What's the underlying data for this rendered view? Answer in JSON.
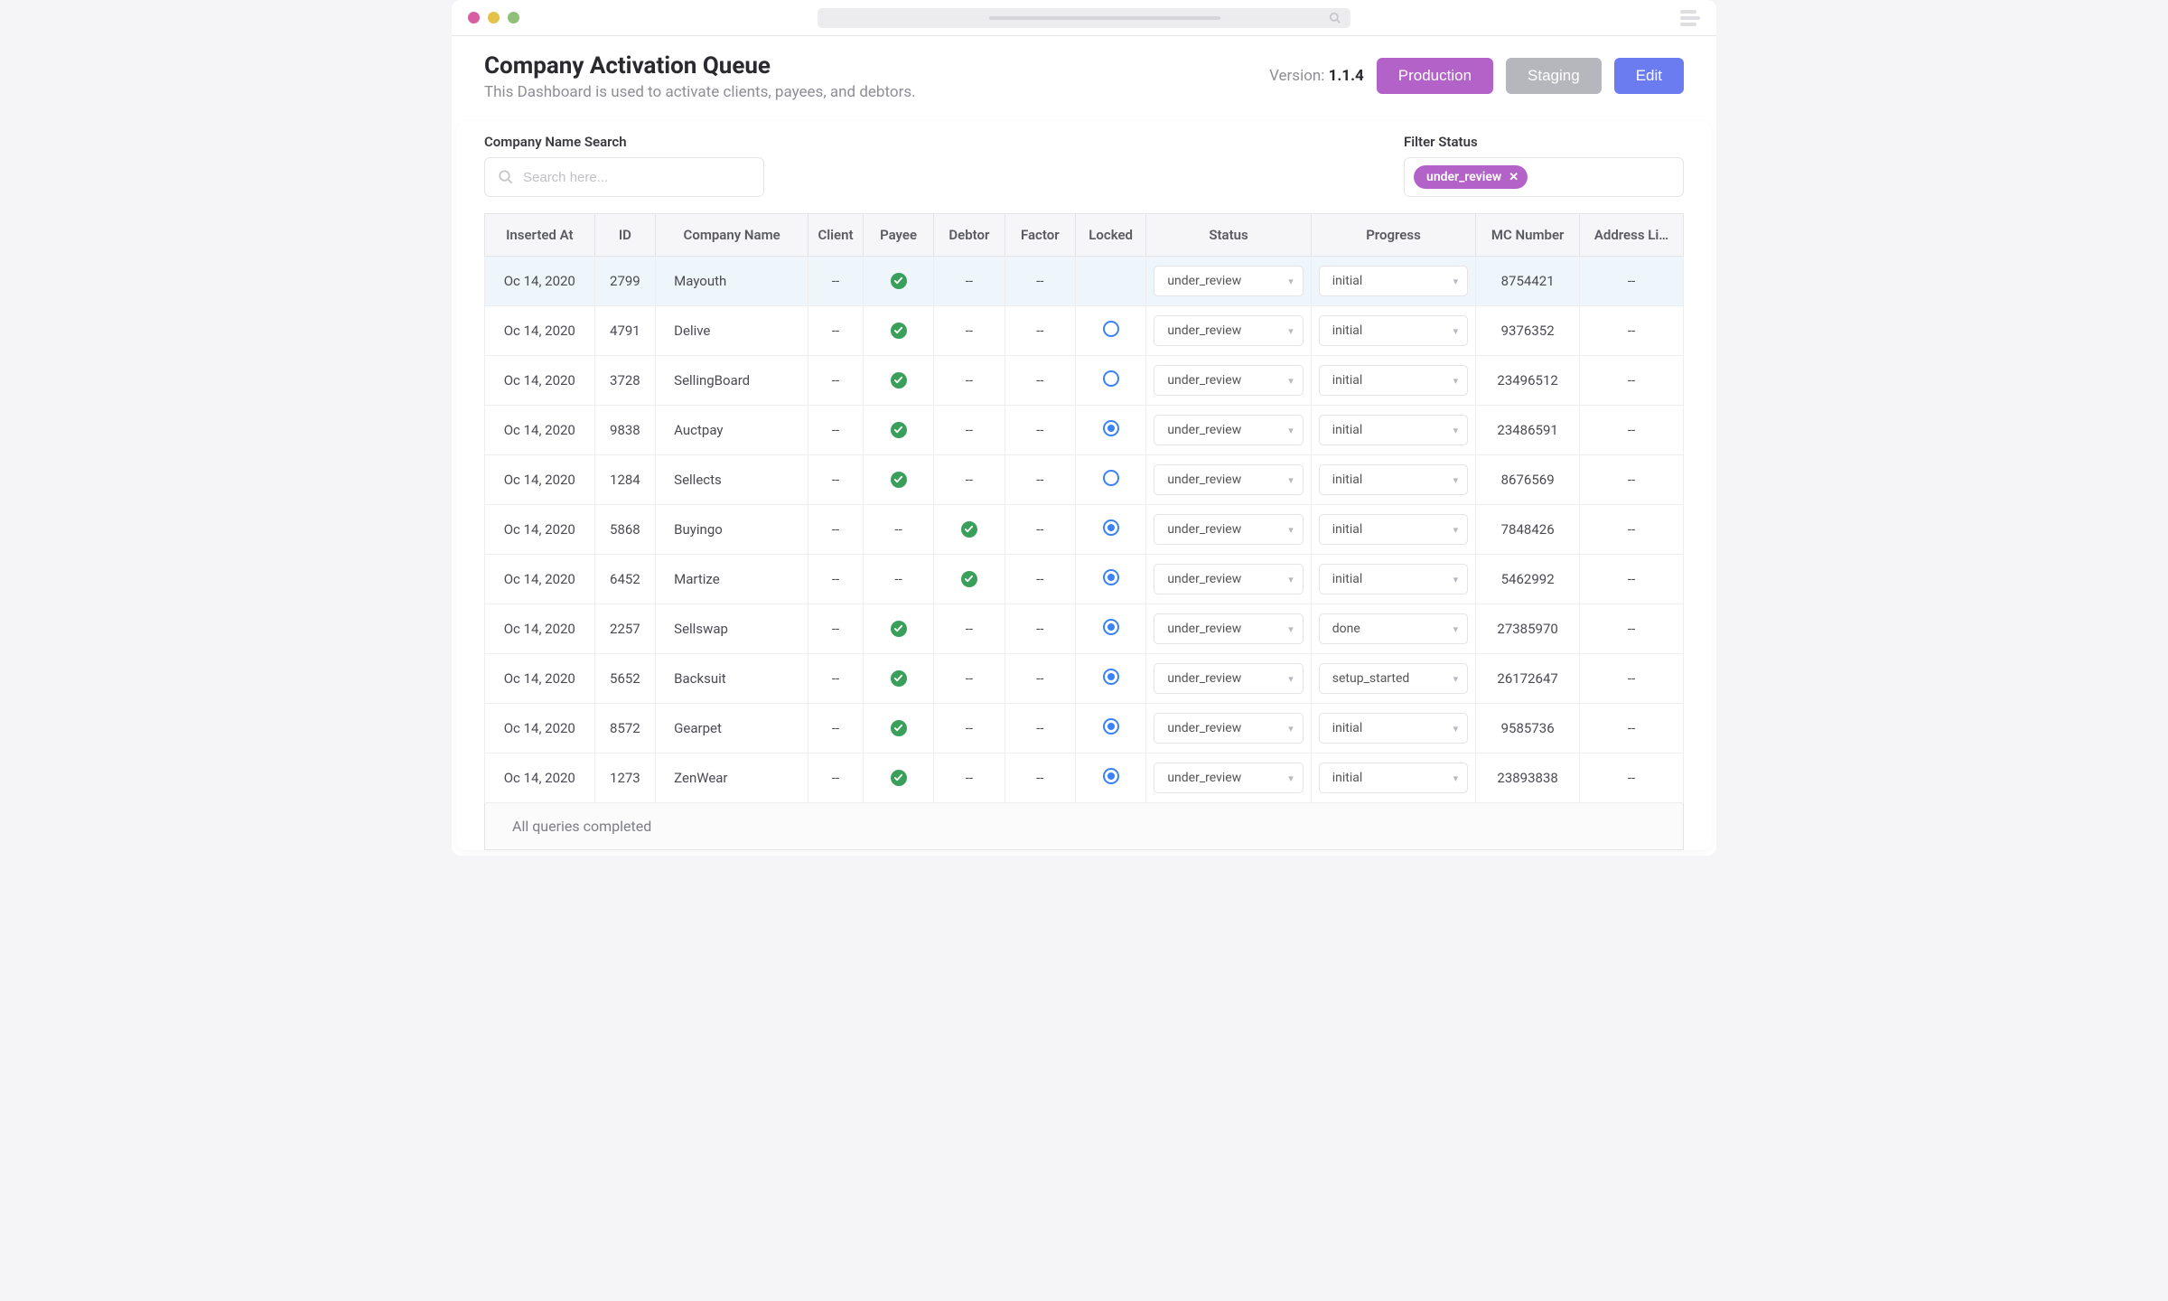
{
  "header": {
    "title": "Company Activation Queue",
    "subtitle": "This Dashboard is used to activate clients, payees, and debtors.",
    "version_label": "Version: ",
    "version": "1.1.4",
    "btn_production": "Production",
    "btn_staging": "Staging",
    "btn_edit": "Edit"
  },
  "search": {
    "label": "Company Name Search",
    "placeholder": "Search here..."
  },
  "filter": {
    "label": "Filter Status",
    "chip": "under_review"
  },
  "columns": {
    "inserted_at": "Inserted At",
    "id": "ID",
    "company_name": "Company Name",
    "client": "Client",
    "payee": "Payee",
    "debtor": "Debtor",
    "factor": "Factor",
    "locked": "Locked",
    "status": "Status",
    "progress": "Progress",
    "mc_number": "MC Number",
    "address": "Address Li…"
  },
  "dash": "--",
  "rows": [
    {
      "inserted_at": "Oc 14, 2020",
      "id": "2799",
      "name": "Mayouth",
      "client": "dash",
      "payee": "check",
      "debtor": "dash",
      "factor": "dash",
      "locked": "none",
      "status": "under_review",
      "progress": "initial",
      "mc": "8754421",
      "addr": "--",
      "hl": true
    },
    {
      "inserted_at": "Oc 14, 2020",
      "id": "4791",
      "name": "Delive",
      "client": "dash",
      "payee": "check",
      "debtor": "dash",
      "factor": "dash",
      "locked": "open",
      "status": "under_review",
      "progress": "initial",
      "mc": "9376352",
      "addr": "--"
    },
    {
      "inserted_at": "Oc 14, 2020",
      "id": "3728",
      "name": "SellingBoard",
      "client": "dash",
      "payee": "check",
      "debtor": "dash",
      "factor": "dash",
      "locked": "open",
      "status": "under_review",
      "progress": "initial",
      "mc": "23496512",
      "addr": "--"
    },
    {
      "inserted_at": "Oc 14, 2020",
      "id": "9838",
      "name": "Auctpay",
      "client": "dash",
      "payee": "check",
      "debtor": "dash",
      "factor": "dash",
      "locked": "filled",
      "status": "under_review",
      "progress": "initial",
      "mc": "23486591",
      "addr": "--"
    },
    {
      "inserted_at": "Oc 14, 2020",
      "id": "1284",
      "name": "Sellects",
      "client": "dash",
      "payee": "check",
      "debtor": "dash",
      "factor": "dash",
      "locked": "open",
      "status": "under_review",
      "progress": "initial",
      "mc": "8676569",
      "addr": "--"
    },
    {
      "inserted_at": "Oc 14, 2020",
      "id": "5868",
      "name": "Buyingo",
      "client": "dash",
      "payee": "dash",
      "debtor": "check",
      "factor": "dash",
      "locked": "filled",
      "status": "under_review",
      "progress": "initial",
      "mc": "7848426",
      "addr": "--"
    },
    {
      "inserted_at": "Oc 14, 2020",
      "id": "6452",
      "name": "Martize",
      "client": "dash",
      "payee": "dash",
      "debtor": "check",
      "factor": "dash",
      "locked": "filled",
      "status": "under_review",
      "progress": "initial",
      "mc": "5462992",
      "addr": "--"
    },
    {
      "inserted_at": "Oc 14, 2020",
      "id": "2257",
      "name": "Sellswap",
      "client": "dash",
      "payee": "check",
      "debtor": "dash",
      "factor": "dash",
      "locked": "filled",
      "status": "under_review",
      "progress": "done",
      "mc": "27385970",
      "addr": "--"
    },
    {
      "inserted_at": "Oc 14, 2020",
      "id": "5652",
      "name": "Backsuit",
      "client": "dash",
      "payee": "check",
      "debtor": "dash",
      "factor": "dash",
      "locked": "filled",
      "status": "under_review",
      "progress": "setup_started",
      "mc": "26172647",
      "addr": "--"
    },
    {
      "inserted_at": "Oc 14, 2020",
      "id": "8572",
      "name": "Gearpet",
      "client": "dash",
      "payee": "check",
      "debtor": "dash",
      "factor": "dash",
      "locked": "filled",
      "status": "under_review",
      "progress": "initial",
      "mc": "9585736",
      "addr": "--"
    },
    {
      "inserted_at": "Oc 14, 2020",
      "id": "1273",
      "name": "ZenWear",
      "client": "dash",
      "payee": "check",
      "debtor": "dash",
      "factor": "dash",
      "locked": "filled",
      "status": "under_review",
      "progress": "initial",
      "mc": "23893838",
      "addr": "--"
    }
  ],
  "footer": "All queries completed"
}
